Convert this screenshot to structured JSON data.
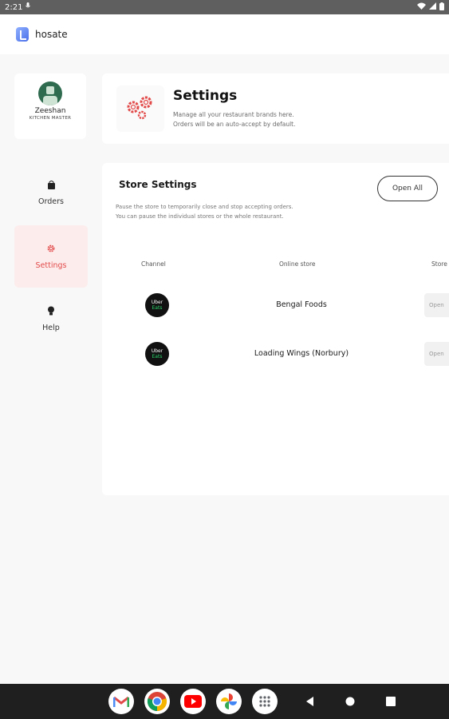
{
  "status_bar": {
    "time": "2:21"
  },
  "app": {
    "brand_name": "hosate"
  },
  "profile": {
    "name": "Zeeshan",
    "role": "KITCHEN MASTER"
  },
  "nav": {
    "items": [
      {
        "label": "Orders",
        "icon": "bag-icon"
      },
      {
        "label": "Settings",
        "icon": "gear-icon",
        "active": true
      },
      {
        "label": "Help",
        "icon": "bulb-icon"
      }
    ]
  },
  "settings_header": {
    "title": "Settings",
    "subtitle_line1": "Manage all your restaurant brands here.",
    "subtitle_line2": "Orders will be an auto-accept by default."
  },
  "store_settings": {
    "title": "Store Settings",
    "open_all_label": "Open All",
    "description_line1": "Pause the store to temporarily close and stop accepting orders.",
    "description_line2": "You can pause the individual stores or the whole restaurant.",
    "columns": [
      "Channel",
      "Online store",
      "Store"
    ],
    "rows": [
      {
        "channel_line1": "Uber",
        "channel_line2": "Eats",
        "store_name": "Bengal Foods",
        "status": "Open"
      },
      {
        "channel_line1": "Uber",
        "channel_line2": "Eats",
        "store_name": "Loading Wings (Norbury)",
        "status": "Open"
      }
    ]
  },
  "colors": {
    "accent": "#e24a4a",
    "active_nav_bg": "#fdecec",
    "uber_green": "#2bd46b",
    "avatar": "#2f6b4f"
  },
  "dock": {
    "apps": [
      "gmail-icon",
      "chrome-icon",
      "youtube-icon",
      "photos-icon",
      "app-drawer-icon"
    ],
    "system_buttons": [
      "back-icon",
      "home-icon",
      "recents-icon"
    ]
  }
}
